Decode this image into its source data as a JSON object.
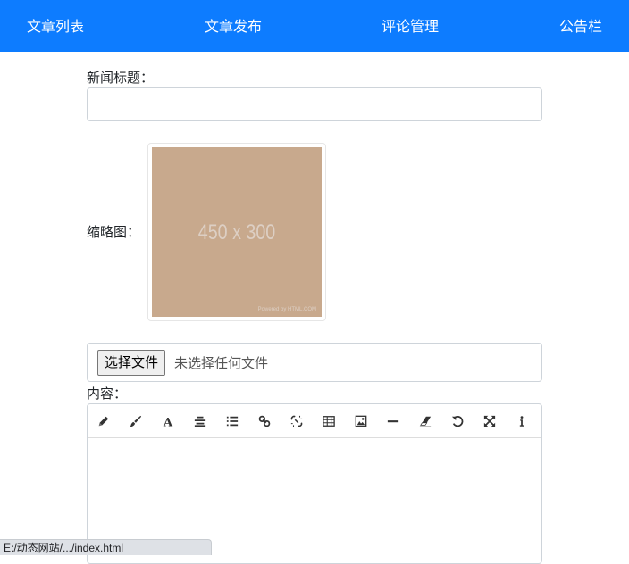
{
  "nav": {
    "items": [
      {
        "label": "文章列表"
      },
      {
        "label": "文章发布"
      },
      {
        "label": "评论管理"
      },
      {
        "label": "公告栏"
      }
    ],
    "background": "#0d7cff"
  },
  "form": {
    "title_label": "新闻标题：",
    "title_value": "",
    "thumbnail_label": "缩略图：",
    "thumbnail_text": "450 x 300",
    "thumbnail_credit": "Powered by HTML.COM",
    "file_button": "选择文件",
    "file_status": "未选择任何文件",
    "content_label": "内容："
  },
  "editor": {
    "tools": [
      {
        "icon": "pencil-icon"
      },
      {
        "icon": "brush-icon"
      },
      {
        "icon": "font-icon"
      },
      {
        "icon": "align-center-icon"
      },
      {
        "icon": "list-icon"
      },
      {
        "icon": "link-icon"
      },
      {
        "icon": "unlink-icon"
      },
      {
        "icon": "table-icon"
      },
      {
        "icon": "image-icon"
      },
      {
        "icon": "horizontal-rule-icon"
      },
      {
        "icon": "eraser-icon"
      },
      {
        "icon": "undo-icon"
      },
      {
        "icon": "fullscreen-icon"
      },
      {
        "icon": "info-icon"
      }
    ]
  },
  "status_bar": {
    "url": "E:/动态网站/.../index.html"
  }
}
